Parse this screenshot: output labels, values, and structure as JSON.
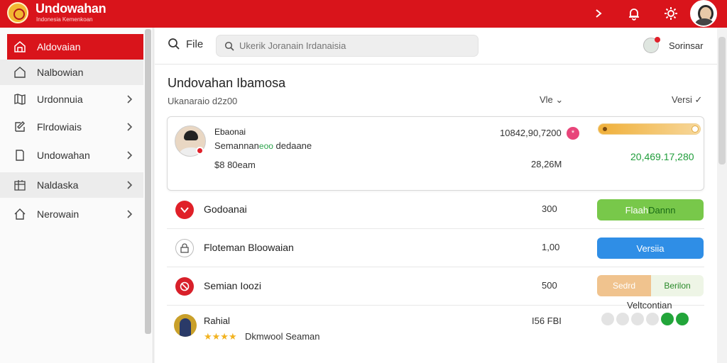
{
  "app": {
    "title": "Undowahan",
    "subtitle": "Indonesia Kemenkoan"
  },
  "topbar": {
    "icons": [
      "chevron-right-icon",
      "bell-icon",
      "gear-icon"
    ]
  },
  "sidebar": {
    "items": [
      {
        "label": "Aldovaian",
        "icon": "home-icon",
        "active": true,
        "chevron": false
      },
      {
        "label": "Nalbowian",
        "icon": "house-outline-icon",
        "active": false,
        "chevron": false
      },
      {
        "label": "Urdonnuia",
        "icon": "map-icon",
        "active": false,
        "chevron": true
      },
      {
        "label": "Flrdowiais",
        "icon": "edit-icon",
        "active": false,
        "chevron": true
      },
      {
        "label": "Undowahan",
        "icon": "document-icon",
        "active": false,
        "chevron": true
      },
      {
        "label": "Naldaska",
        "icon": "grid-icon",
        "active": false,
        "chevron": true
      },
      {
        "label": "Nerowain",
        "icon": "home-icon",
        "active": false,
        "chevron": true
      }
    ]
  },
  "header": {
    "file_label": "File",
    "search_placeholder": "Ukerik Joranain Irdanaisia",
    "user_name": "Sorinsar"
  },
  "page": {
    "title": "Undovahan Ibamosa",
    "subtitle": "Ukanaraio d2z00",
    "view_label": "Vle",
    "version_label": "Versi"
  },
  "card": {
    "name": "Ebaonai",
    "desc_main": "Semannan",
    "desc_green": "eoo",
    "desc_tail": " dedaane",
    "price": "$8 80eam",
    "number_top": "10842,90,7200",
    "pink_badge": "*",
    "number_bottom": "28,26M",
    "progress_percent": 100,
    "green_value": "20,469.17,280"
  },
  "rows": [
    {
      "label": "Godoanai",
      "num": "300",
      "icon": "shield-icon",
      "action": "green",
      "action_label": "Flaah",
      "action_highlight": "Dannn"
    },
    {
      "label": "Floteman Bloowaian",
      "num": "1,00",
      "icon": "lock-icon",
      "action": "blue",
      "action_label": "Versiia"
    },
    {
      "label": "Semian Ioozi",
      "num": "500",
      "icon": "no-entry-icon",
      "action": "split",
      "split_left": "Sedrd",
      "split_right": "Berilon"
    }
  ],
  "last_row": {
    "name": "Rahial",
    "stars": "★★★★",
    "sub": "Dkmwool Seaman",
    "num": "I56 FBI",
    "dots_label": "Veltcontian",
    "dots_on": [
      false,
      false,
      false,
      false,
      true,
      true
    ]
  },
  "colors": {
    "brand_red": "#d9141b",
    "green": "#78c84a",
    "blue": "#2f8ee6",
    "star": "#f2b320"
  }
}
